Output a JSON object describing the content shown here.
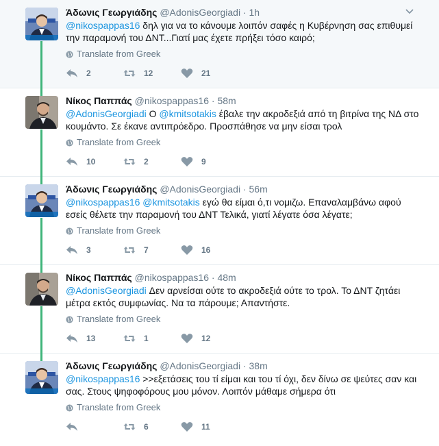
{
  "ui": {
    "translate_label": "Translate from Greek",
    "dot": "·"
  },
  "colors": {
    "thread_line": "#3fb47a",
    "link": "#1b95e0",
    "muted": "#657786",
    "highlight_bg": "#f5f8fa"
  },
  "tweets": [
    {
      "name": "Άδωνις Γεωργιάδης",
      "handle": "@AdonisGeorgiadi",
      "time": "1h",
      "mention": "@nikospappas16",
      "body": " δηλ για να το κάνουμε λοιπόν σαφές η Κυβέρνηση σας επιθυμεί την παραμονή του ΔΝΤ...Γιατί μας έχετε πρήξει τόσο καιρό;",
      "replies": "2",
      "retweets": "12",
      "likes": "21",
      "avatar_icon": "avatar-adonis"
    },
    {
      "name": "Νίκος Παππάς",
      "handle": "@nikospappas16",
      "time": "58m",
      "mention": "@AdonisGeorgiadi",
      "body_pre": " Ο ",
      "mention2": "@kmitsotakis",
      "body": " έβαλε την ακροδεξιά από τη βιτρίνα της ΝΔ στο κουμάντο. Σε έκανε αντιπρόεδρο. Προσπάθησε να μην είσαι τρολ",
      "replies": "10",
      "retweets": "2",
      "likes": "9",
      "avatar_icon": "avatar-nikos"
    },
    {
      "name": "Άδωνις Γεωργιάδης",
      "handle": "@AdonisGeorgiadi",
      "time": "56m",
      "mention": "@nikospappas16",
      "body_pre": " ",
      "mention2": "@kmitsotakis",
      "body": " εγώ θα είμαι ό,τι νομιζω. Επαναλαμβάνω αφού εσείς θέλετε την παραμονή του ΔΝΤ Τελικά, γιατί λέγατε όσα λέγατε;",
      "replies": "3",
      "retweets": "7",
      "likes": "16",
      "avatar_icon": "avatar-adonis"
    },
    {
      "name": "Νίκος Παππάς",
      "handle": "@nikospappas16",
      "time": "48m",
      "mention": "@AdonisGeorgiadi",
      "body": " Δεν αρνείσαι ούτε το ακροδεξιά ούτε το τρολ. Το ΔΝΤ ζητάει μέτρα εκτός συμφωνίας. Να τα πάρουμε; Απαντήστε.",
      "replies": "13",
      "retweets": "1",
      "likes": "12",
      "avatar_icon": "avatar-nikos"
    },
    {
      "name": "Άδωνις Γεωργιάδης",
      "handle": "@AdonisGeorgiadi",
      "time": "38m",
      "mention": "@nikospappas16",
      "body": " >>εξετάσεις του τί είμαι και του τί όχι, δεν δίνω σε ψεύτες σαν και σας. Στους ψηφοφόρους μου μόνον. Λοιπόν μάθαμε σήμερα ότι",
      "replies": "",
      "retweets": "6",
      "likes": "11",
      "avatar_icon": "avatar-adonis"
    }
  ]
}
